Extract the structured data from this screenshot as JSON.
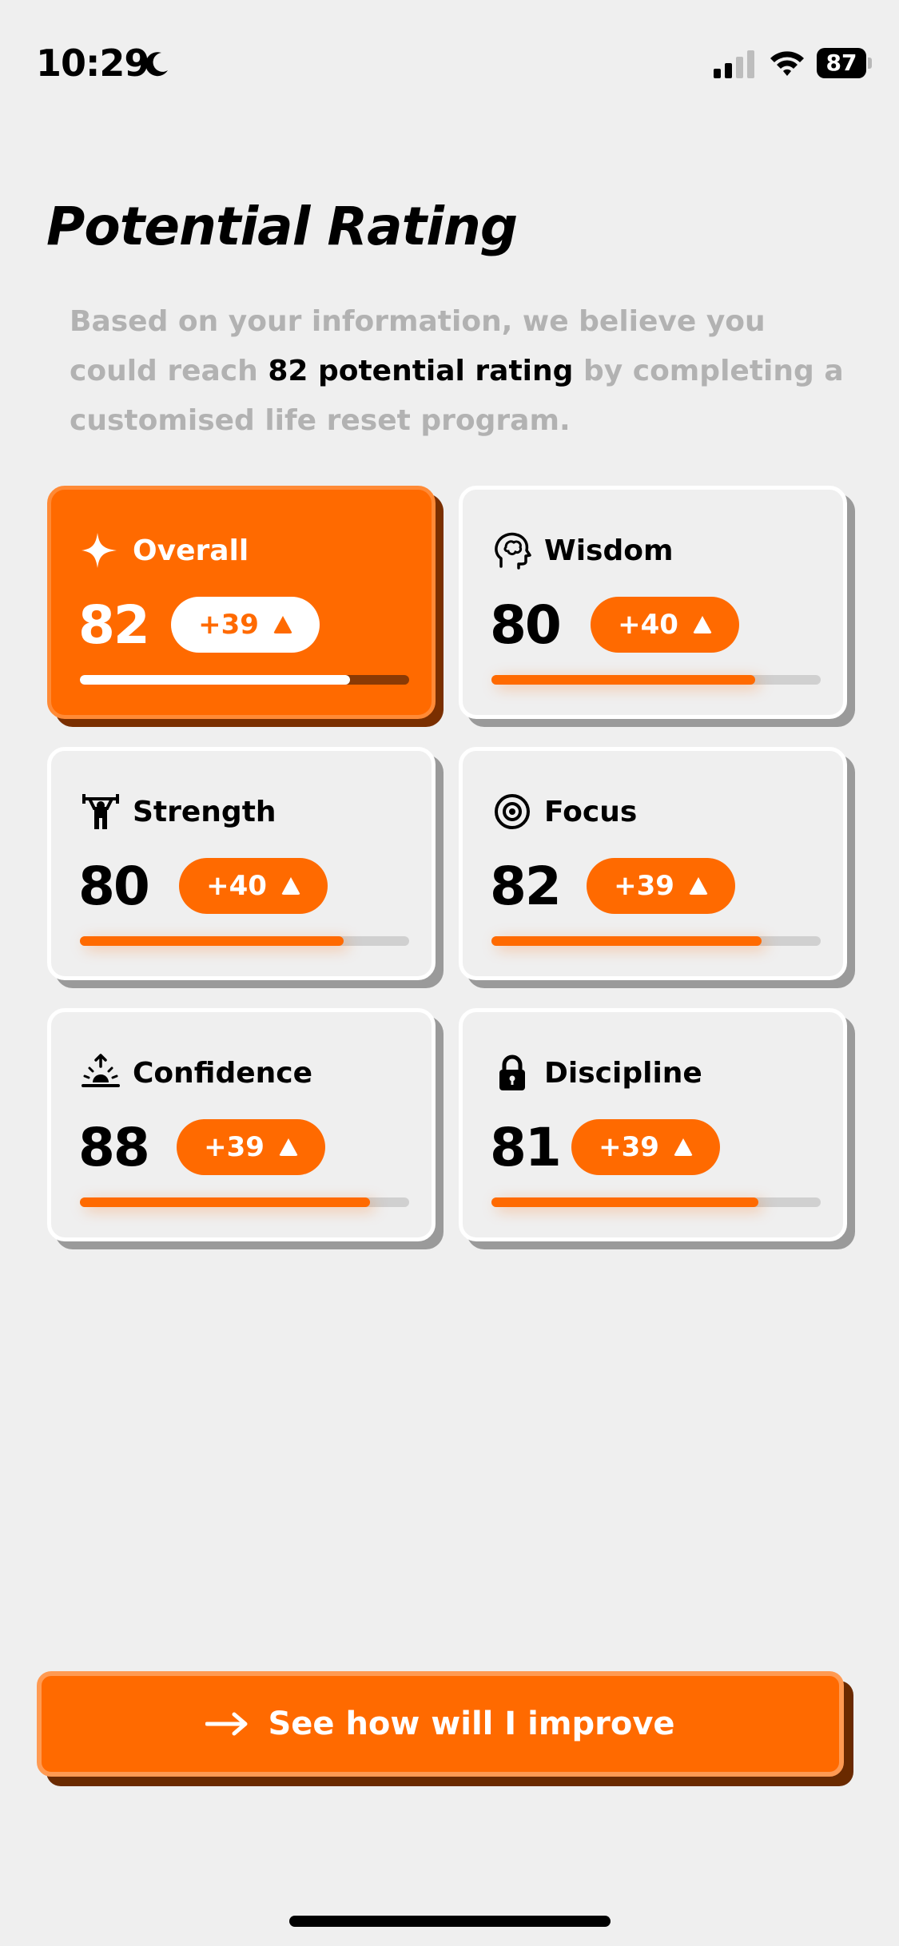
{
  "status": {
    "time": "10:29",
    "battery": "87"
  },
  "title": "Potential Rating",
  "description": {
    "part1": "Based on your information, we believe you could reach ",
    "highlight": "82 potential rating",
    "part2": " by completing a customised life reset program."
  },
  "cards": [
    {
      "name": "Overall",
      "score": "82",
      "delta": "+39",
      "progress": 0.82,
      "icon": "sparkle-icon"
    },
    {
      "name": "Wisdom",
      "score": "80",
      "delta": "+40",
      "progress": 0.8,
      "icon": "brain-head-icon"
    },
    {
      "name": "Strength",
      "score": "80",
      "delta": "+40",
      "progress": 0.8,
      "icon": "weightlifter-icon"
    },
    {
      "name": "Focus",
      "score": "82",
      "delta": "+39",
      "progress": 0.82,
      "icon": "target-icon"
    },
    {
      "name": "Confidence",
      "score": "88",
      "delta": "+39",
      "progress": 0.88,
      "icon": "sunrise-icon"
    },
    {
      "name": "Discipline",
      "score": "81",
      "delta": "+39",
      "progress": 0.81,
      "icon": "lock-icon"
    }
  ],
  "cta_label": "See how will I improve",
  "colors": {
    "accent": "#ff6a00",
    "background": "#efefef"
  }
}
